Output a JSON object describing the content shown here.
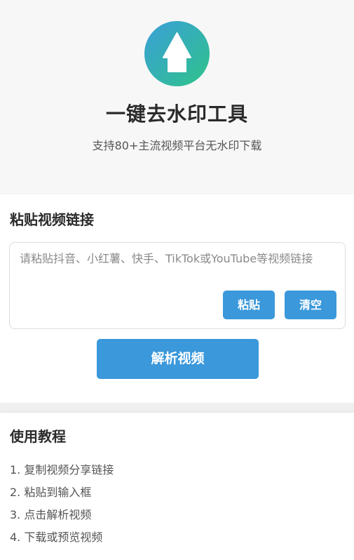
{
  "header": {
    "logo_icon": "upload-arrow-icon",
    "title": "一键去水印工具",
    "subtitle": "支持80+主流视频平台无水印下载"
  },
  "input_section": {
    "title": "粘贴视频链接",
    "placeholder": "请粘贴抖音、小红薯、快手、TikTok或YouTube等视频链接",
    "value": "",
    "paste_label": "粘贴",
    "clear_label": "清空",
    "parse_label": "解析视频"
  },
  "guide_section": {
    "title": "使用教程",
    "steps": [
      "1. 复制视频分享链接",
      "2. 粘贴到输入框",
      "3. 点击解析视频",
      "4. 下载或预览视频"
    ]
  },
  "colors": {
    "primary": "#3a98db",
    "logo_gradient_start": "#3a9fd8",
    "logo_gradient_end": "#2fc38a",
    "background": "#f7f7f7"
  }
}
